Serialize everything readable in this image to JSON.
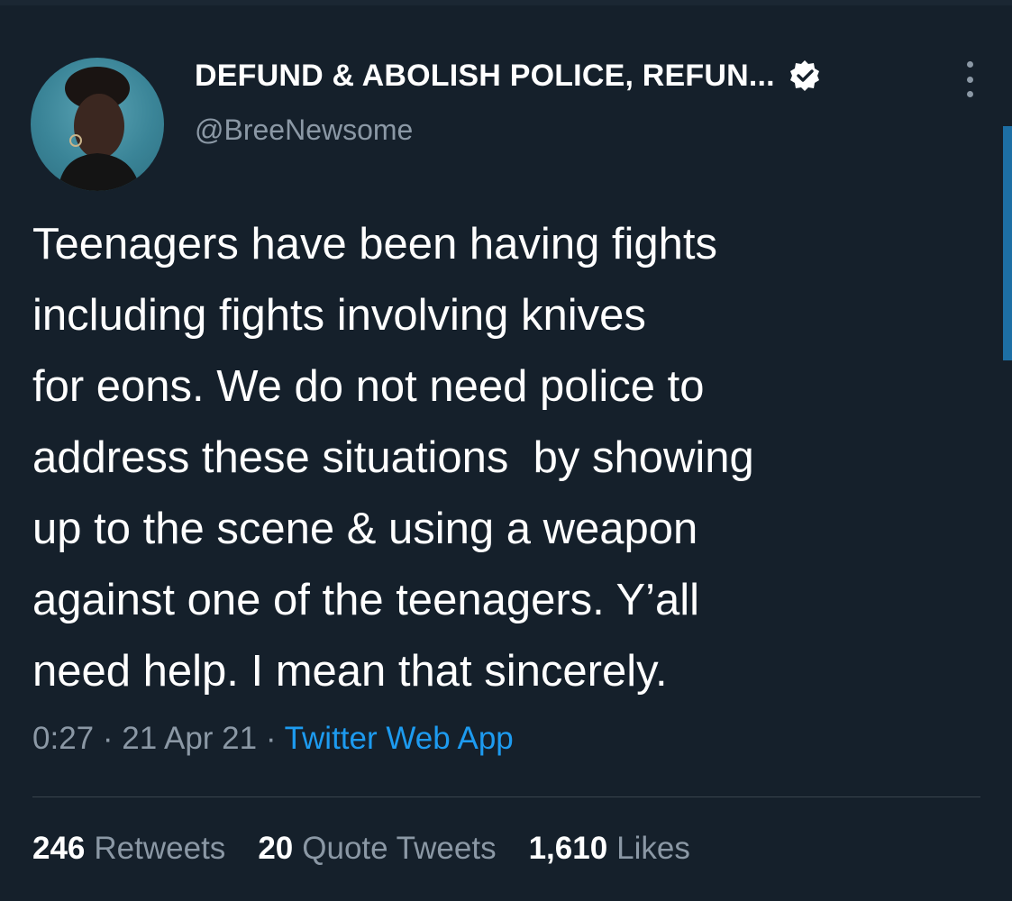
{
  "tweet": {
    "display_name": "DEFUND & ABOLISH POLICE, REFUN...",
    "handle": "@BreeNewsome",
    "verified": true,
    "text": "Teenagers have been having fights\nincluding fights involving knives\nfor eons. We do not need police to\naddress these situations  by showing\nup to the scene & using a weapon\nagainst one of the teenagers. Y’all\nneed help. I mean that sincerely.",
    "time": "0:27",
    "date": "21 Apr 21",
    "separator": "·",
    "source": "Twitter Web App"
  },
  "stats": {
    "retweets_count": "246",
    "retweets_label": "Retweets",
    "quote_count": "20",
    "quote_label": "Quote Tweets",
    "likes_count": "1,610",
    "likes_label": "Likes"
  },
  "icons": {
    "verified": "verified-badge-icon",
    "more": "more-vertical-icon"
  },
  "colors": {
    "background": "#15202b",
    "secondary_text": "#8b98a5",
    "link": "#1d9bf0",
    "divider": "#38444d"
  }
}
